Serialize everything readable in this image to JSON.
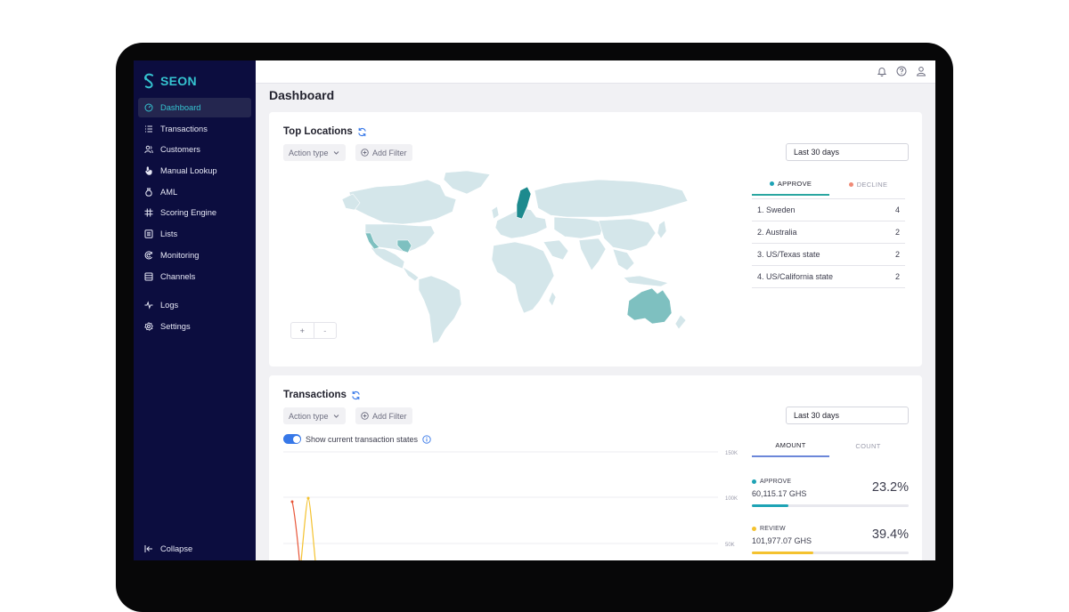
{
  "brand": {
    "name": "SEON"
  },
  "sidebar": {
    "items": [
      {
        "label": "Dashboard",
        "icon": "dashboard-icon",
        "active": true
      },
      {
        "label": "Transactions",
        "icon": "list-icon"
      },
      {
        "label": "Customers",
        "icon": "users-icon"
      },
      {
        "label": "Manual Lookup",
        "icon": "hand-pointer-icon"
      },
      {
        "label": "AML",
        "icon": "money-bag-icon"
      },
      {
        "label": "Scoring Engine",
        "icon": "hash-grid-icon"
      },
      {
        "label": "Lists",
        "icon": "list-box-icon"
      },
      {
        "label": "Monitoring",
        "icon": "target-icon"
      },
      {
        "label": "Channels",
        "icon": "stack-icon"
      }
    ],
    "secondary": [
      {
        "label": "Logs",
        "icon": "pulse-icon"
      },
      {
        "label": "Settings",
        "icon": "gear-icon"
      }
    ],
    "collapse_label": "Collapse"
  },
  "header": {
    "title": "Dashboard"
  },
  "top_locations": {
    "title": "Top Locations",
    "action_type_label": "Action type",
    "add_filter_label": "Add Filter",
    "date_range": "Last 30 days",
    "zoom_in": "+",
    "zoom_out": "-",
    "tabs": [
      {
        "label": "APPROVE",
        "color": "#1ea3b5",
        "active": true
      },
      {
        "label": "DECLINE",
        "color": "#f08a76",
        "active": false
      }
    ],
    "locations": [
      {
        "label": "1. Sweden",
        "count": "4"
      },
      {
        "label": "2. Australia",
        "count": "2"
      },
      {
        "label": "3. US/Texas state",
        "count": "2"
      },
      {
        "label": "4. US/California state",
        "count": "2"
      }
    ],
    "map_colors": {
      "base": "#d4e6ea",
      "highlight": "#7ec0c0",
      "top": "#1d8a8e"
    }
  },
  "transactions": {
    "title": "Transactions",
    "action_type_label": "Action type",
    "add_filter_label": "Add Filter",
    "date_range": "Last 30 days",
    "toggle_label": "Show current transaction states",
    "tabs": [
      {
        "label": "AMOUNT",
        "active": true
      },
      {
        "label": "COUNT",
        "active": false
      }
    ],
    "stats": [
      {
        "label": "APPROVE",
        "amount": "60,115.17 GHS",
        "percent": "23.2%",
        "fraction": 0.232,
        "color": "#1ea3b5"
      },
      {
        "label": "REVIEW",
        "amount": "101,977.07 GHS",
        "percent": "39.4%",
        "fraction": 0.394,
        "color": "#f4c22f"
      }
    ],
    "chart_data": {
      "type": "line",
      "y_ticks": [
        "150K",
        "100K",
        "50K"
      ],
      "series": [
        {
          "color": "#e8573a"
        },
        {
          "color": "#f4c22f"
        }
      ]
    }
  }
}
